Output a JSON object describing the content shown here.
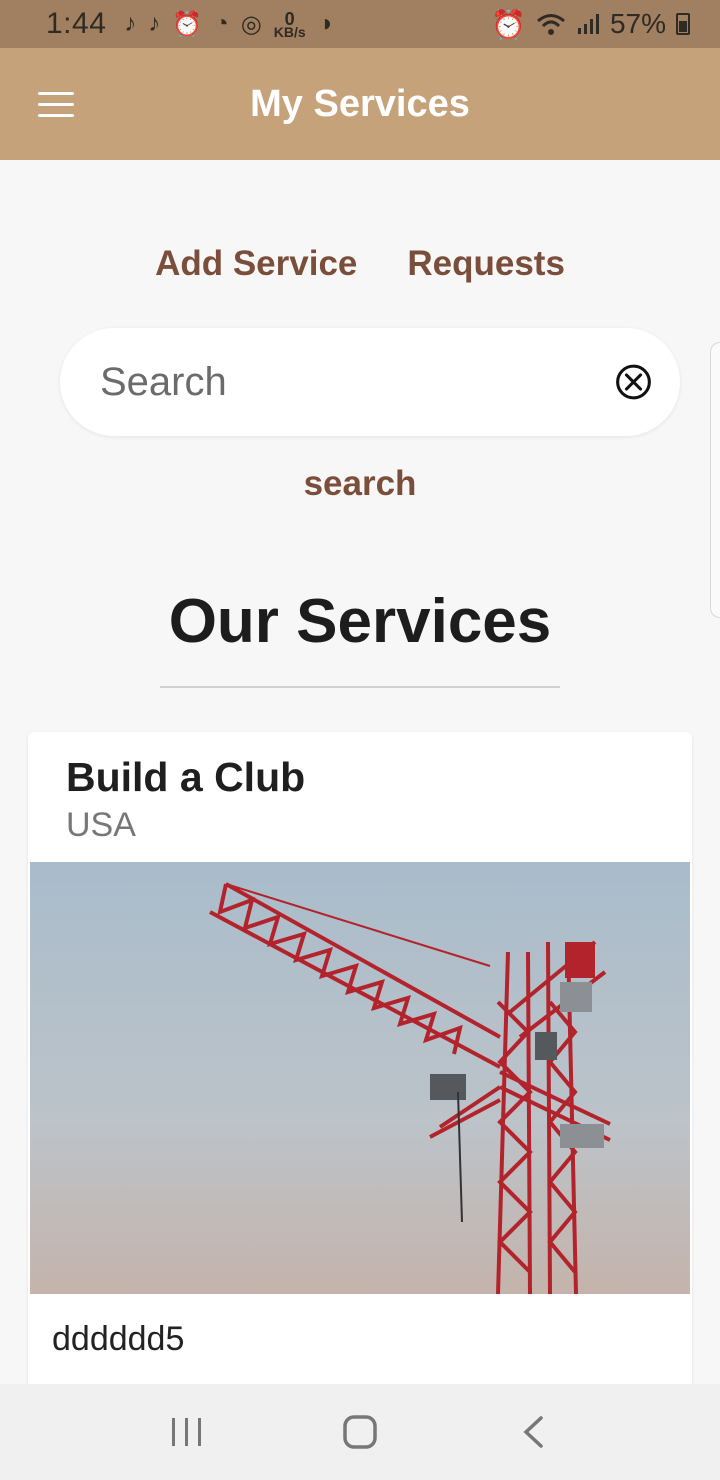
{
  "status": {
    "time": "1:44",
    "kbs_value": "0",
    "kbs_unit": "KB/s",
    "battery": "57%"
  },
  "appbar": {
    "title": "My Services"
  },
  "links": {
    "add_service": "Add Service",
    "requests": "Requests"
  },
  "search": {
    "placeholder": "Search",
    "value": "",
    "button": "search"
  },
  "section": {
    "title": "Our Services"
  },
  "services": [
    {
      "title": "Build a Club",
      "location": "USA",
      "description": "dddddd5"
    }
  ],
  "colors": {
    "appbar": "#c6a27a",
    "statusbar": "#a08060",
    "link": "#7a4e3a",
    "crane": "#b3232b"
  }
}
